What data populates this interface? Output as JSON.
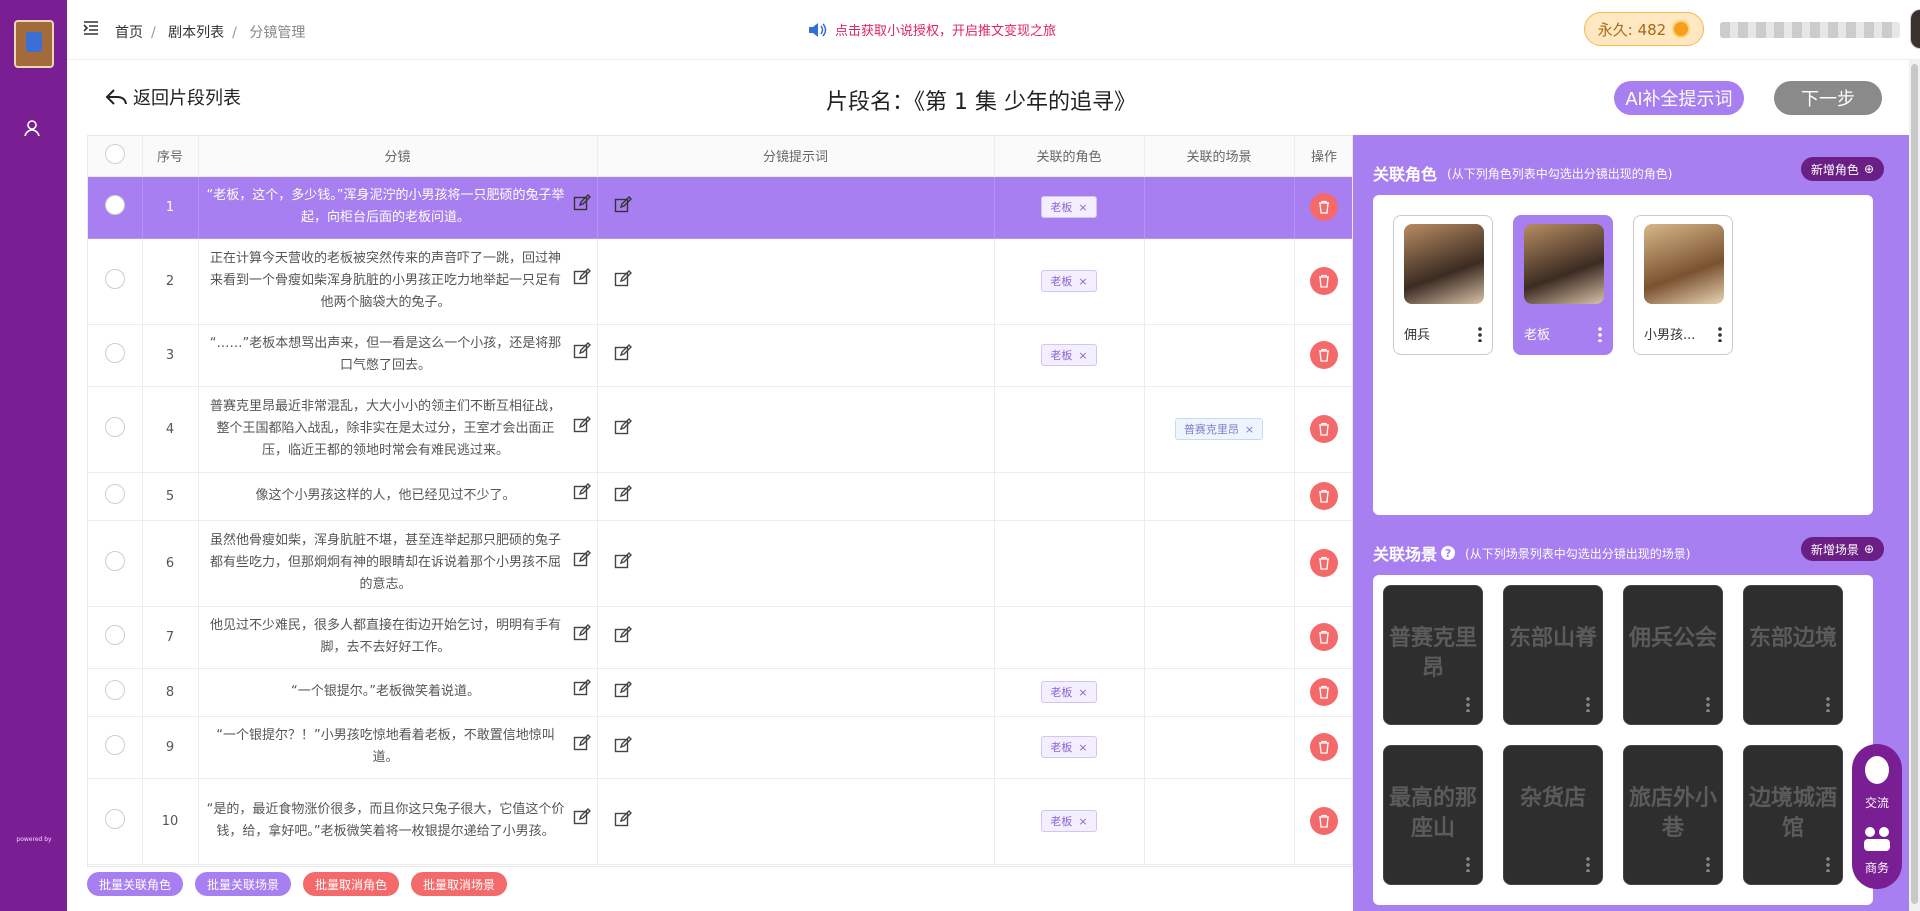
{
  "breadcrumb": [
    "首页",
    "剧本列表",
    "分镜管理"
  ],
  "notice": "点击获取小说授权，开启推文变现之旅",
  "vip_label": "永久: 482",
  "back_label": "返回片段列表",
  "page_title": "片段名：《第 1 集 少年的追寻》",
  "ai_button": "AI补全提示词",
  "next_button": "下一步",
  "powered": "powered by",
  "table": {
    "headers": [
      "序号",
      "分镜",
      "分镜提示词",
      "关联的角色",
      "关联的场景",
      "操作"
    ],
    "rows": [
      {
        "no": "1",
        "text": "“老板，这个，多少钱。”浑身泥泞的小男孩将一只肥硕的兔子举起，向柜台后面的老板问道。",
        "role": "老板",
        "scene": ""
      },
      {
        "no": "2",
        "text": "正在计算今天营收的老板被突然传来的声音吓了一跳，回过神来看到一个骨瘦如柴浑身肮脏的小男孩正吃力地举起一只足有他两个脑袋大的兔子。",
        "role": "老板",
        "scene": ""
      },
      {
        "no": "3",
        "text": "“……”老板本想骂出声来，但一看是这么一个小孩，还是将那口气憋了回去。",
        "role": "老板",
        "scene": ""
      },
      {
        "no": "4",
        "text": "普赛克里昂最近非常混乱，大大小小的领主们不断互相征战，整个王国都陷入战乱，除非实在是太过分，王室才会出面正压，临近王都的领地时常会有难民逃过来。",
        "role": "",
        "scene": "普赛克里昂"
      },
      {
        "no": "5",
        "text": "像这个小男孩这样的人，他已经见过不少了。",
        "role": "",
        "scene": ""
      },
      {
        "no": "6",
        "text": "虽然他骨瘦如柴，浑身肮脏不堪，甚至连举起那只肥硕的兔子都有些吃力，但那炯炯有神的眼睛却在诉说着那个小男孩不屈的意志。",
        "role": "",
        "scene": ""
      },
      {
        "no": "7",
        "text": "他见过不少难民，很多人都直接在街边开始乞讨，明明有手有脚，去不去好好工作。",
        "role": "",
        "scene": ""
      },
      {
        "no": "8",
        "text": "“一个银提尔。”老板微笑着说道。",
        "role": "老板",
        "scene": ""
      },
      {
        "no": "9",
        "text": "“一个银提尔？！”小男孩吃惊地看着老板，不敢置信地惊叫道。",
        "role": "老板",
        "scene": ""
      },
      {
        "no": "10",
        "text": "“是的，最近食物涨价很多，而且你这只兔子很大，它值这个价钱，给，拿好吧。”老板微笑着将一枚银提尔递给了小男孩。",
        "role": "老板",
        "scene": ""
      }
    ]
  },
  "bulk": [
    "批量关联角色",
    "批量关联场景",
    "批量取消角色",
    "批量取消场景"
  ],
  "roles_section": {
    "title": "关联角色",
    "hint": "(从下列角色列表中勾选出分镜出现的角色)",
    "add": "新增角色"
  },
  "roles": [
    {
      "name": "佣兵"
    },
    {
      "name": "老板"
    },
    {
      "name": "小男孩..."
    }
  ],
  "scenes_section": {
    "title": "关联场景",
    "hint": "(从下列场景列表中勾选出分镜出现的场景)",
    "add": "新增场景"
  },
  "scenes": [
    "普赛克里昂",
    "东部山脊",
    "佣兵公会",
    "东部边境",
    "最高的那座山",
    "杂货店",
    "旅店外小巷",
    "边境城酒馆"
  ],
  "float": [
    "交流",
    "商务"
  ],
  "colors": {
    "sidebar": "#7a1f93",
    "accent": "#a77ff0",
    "danger": "#f46a6a"
  }
}
